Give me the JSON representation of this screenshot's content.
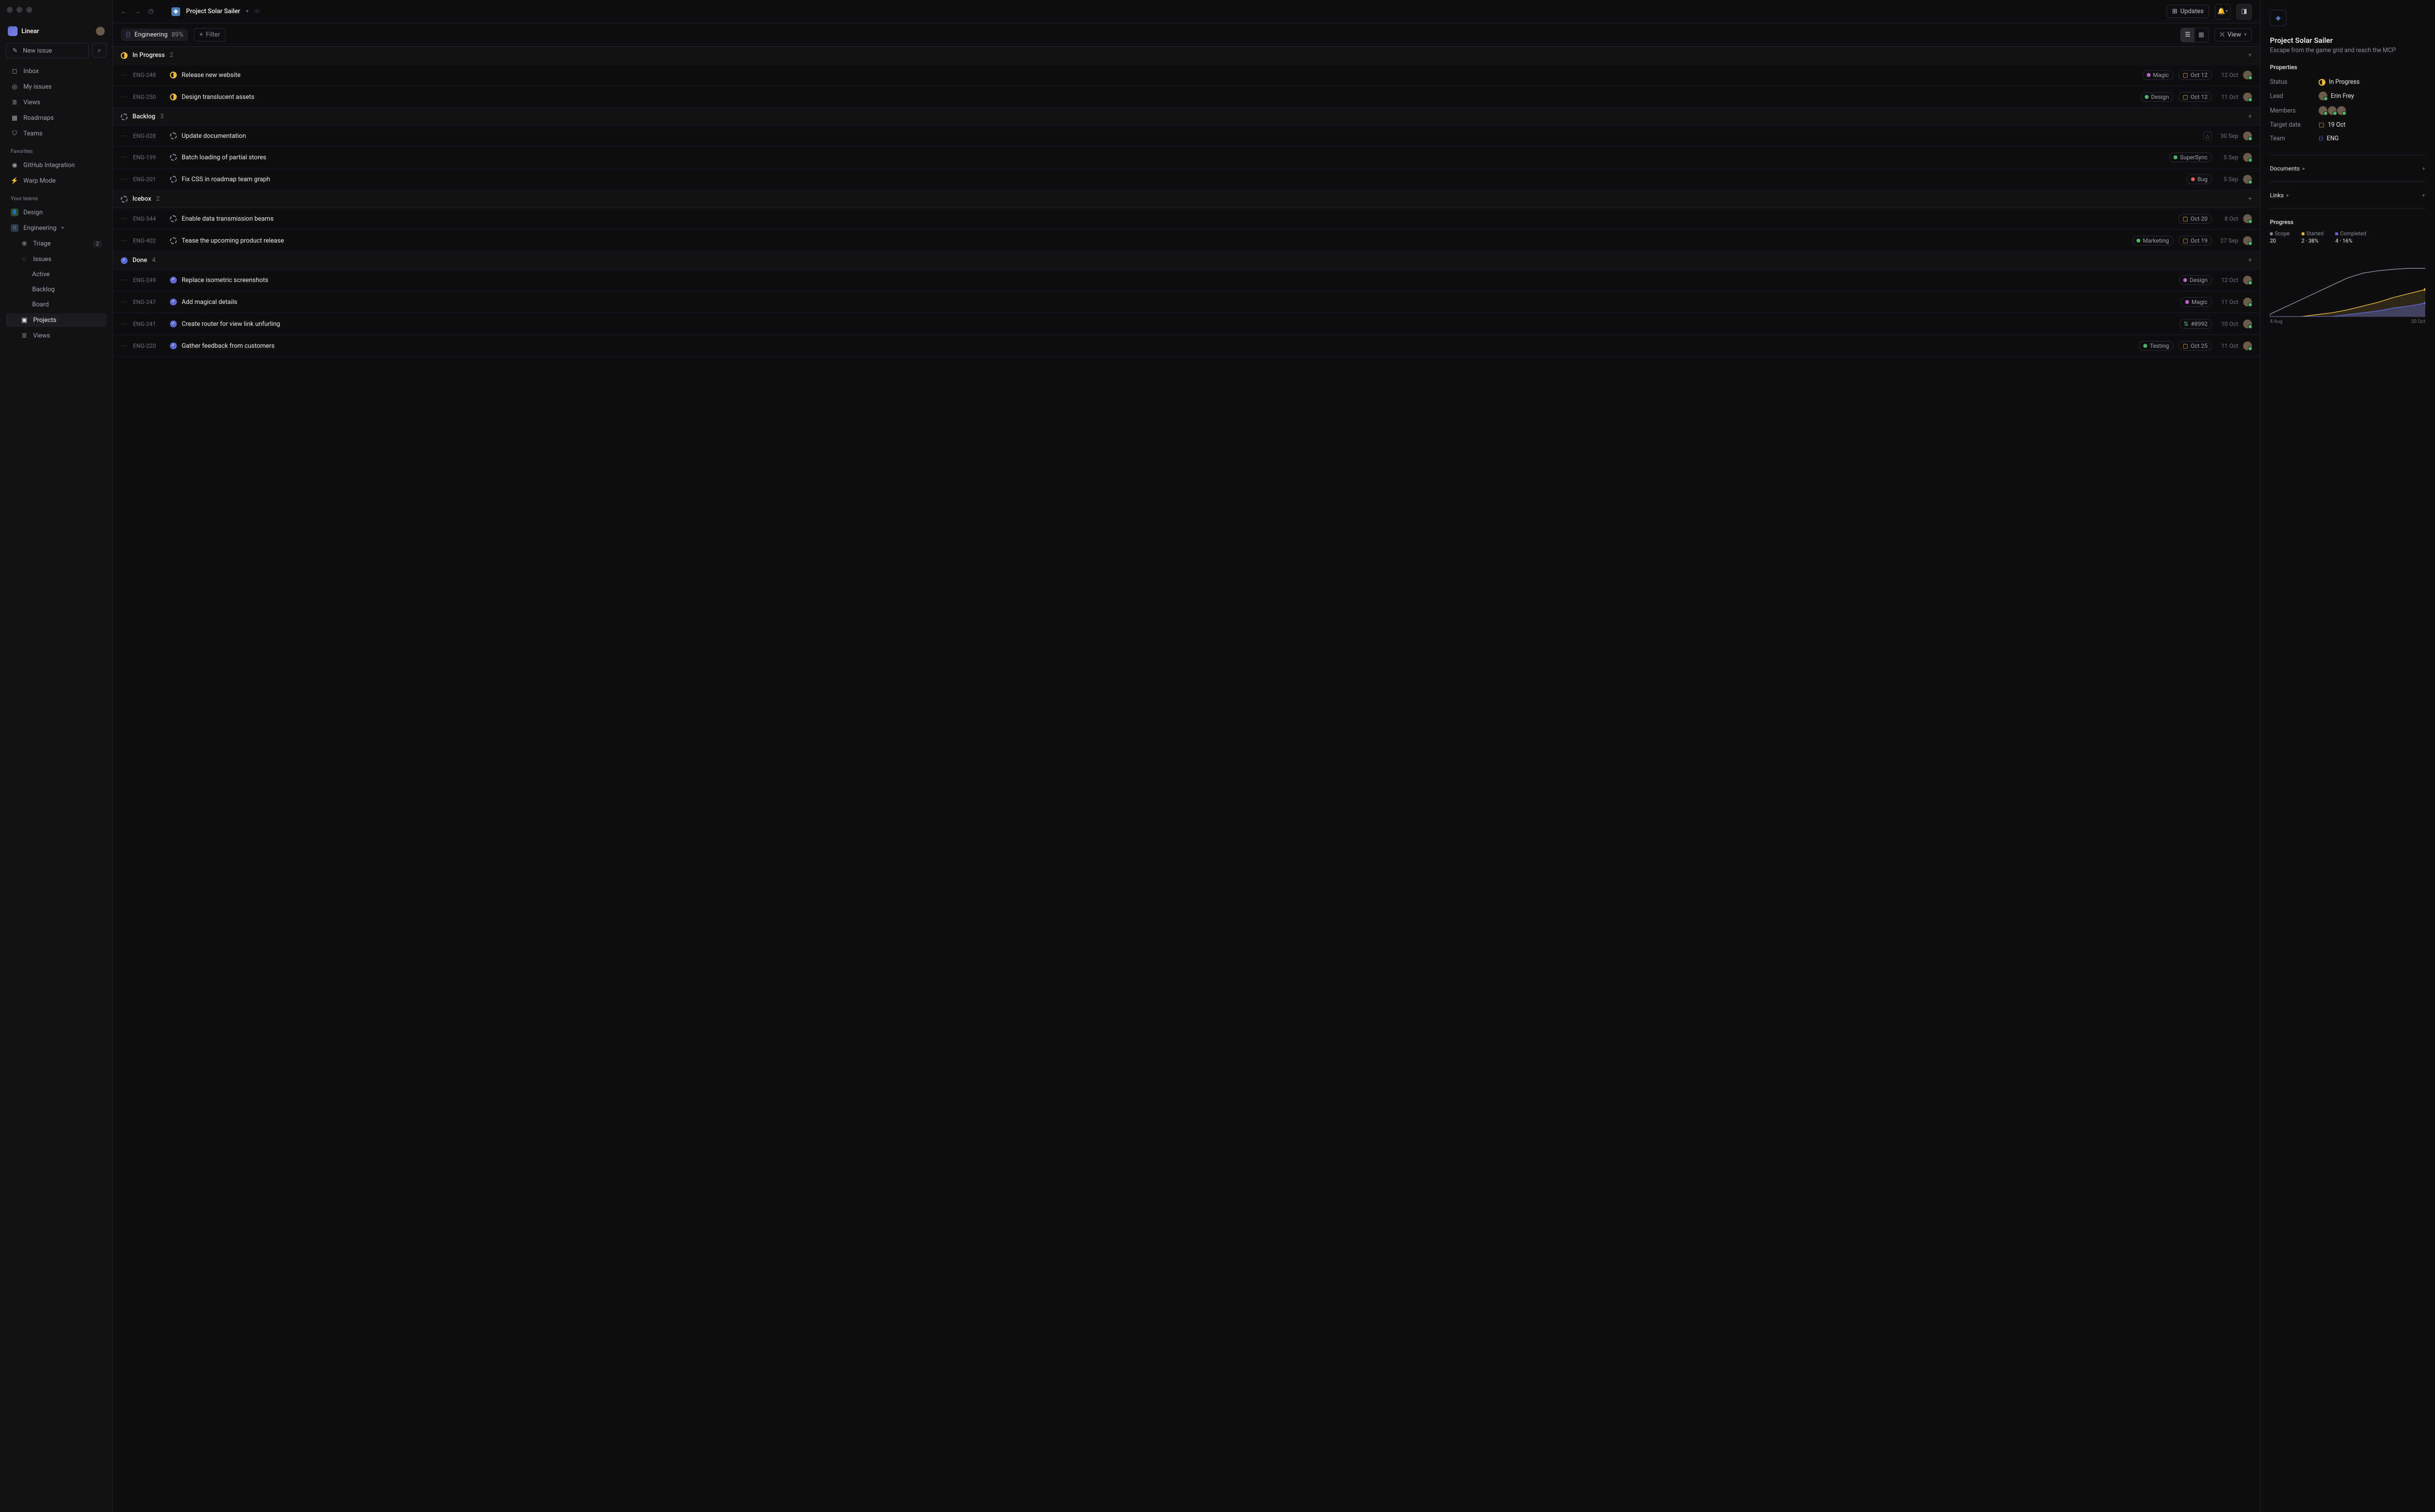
{
  "app": {
    "name": "Linear",
    "new_issue": "New issue"
  },
  "nav": {
    "inbox": "Inbox",
    "my_issues": "My issues",
    "views": "Views",
    "roadmaps": "Roadmaps",
    "teams": "Teams",
    "favorites": "Favorites",
    "github": "GitHub Integration",
    "warp": "Warp Mode",
    "your_teams": "Your teams",
    "design": "Design",
    "engineering": "Engineering",
    "triage": "Triage",
    "triage_cnt": "2",
    "issues": "Issues",
    "active": "Active",
    "backlog": "Backlog",
    "board": "Board",
    "projects": "Projects",
    "views2": "Views"
  },
  "header": {
    "project": "Project Solar Sailer",
    "updates": "Updates",
    "filter": "Filter",
    "view": "View"
  },
  "filter": {
    "team": "Engineering",
    "pct": "89%"
  },
  "groups": [
    {
      "status": "progress",
      "title": "In Progress",
      "count": "2",
      "items": [
        {
          "id": "ENG-248",
          "title": "Release new website",
          "label": "Magic",
          "label_color": "#b85ec9",
          "date": "Oct 12",
          "due": "12 Oct"
        },
        {
          "id": "ENG-250",
          "title": "Design translucent assets",
          "label": "Design",
          "label_color": "#4bb766",
          "date": "Oct 12",
          "due": "11 Oct"
        }
      ]
    },
    {
      "status": "backlog",
      "title": "Backlog",
      "count": "3",
      "items": [
        {
          "id": "ENG-028",
          "title": "Update documentation",
          "tri": true,
          "due": "30 Sep"
        },
        {
          "id": "ENG-199",
          "title": "Batch loading of partial stores",
          "label": "SuperSync",
          "label_color": "#4bb766",
          "due": "5 Sep"
        },
        {
          "id": "ENG-201",
          "title": "Fix CSS in roadmap team graph",
          "label": "Bug",
          "label_color": "#e05d5d",
          "due": "5 Sep"
        }
      ]
    },
    {
      "status": "backlog",
      "title": "Icebox",
      "count": "2",
      "items": [
        {
          "id": "ENG-344",
          "title": "Enable data transmission beams",
          "date": "Oct 20",
          "due": "8 Oct"
        },
        {
          "id": "ENG-402",
          "title": "Tease the upcoming product release",
          "label": "Marketing",
          "label_color": "#4bb766",
          "date": "Oct 19",
          "due": "27 Sep"
        }
      ]
    },
    {
      "status": "done",
      "title": "Done",
      "count": "4",
      "items": [
        {
          "id": "ENG-249",
          "title": "Replace isometric screenshots",
          "label": "Design",
          "label_color": "#b85ec9",
          "due": "12 Oct"
        },
        {
          "id": "ENG-247",
          "title": "Add magical details",
          "label": "Magic",
          "label_color": "#b85ec9",
          "due": "11 Oct"
        },
        {
          "id": "ENG-241",
          "title": "Create router for view link unfurling",
          "pr": "#8992",
          "due": "10 Oct"
        },
        {
          "id": "ENG-220",
          "title": "Gather feedback from customers",
          "label": "Testing",
          "label_color": "#4bb766",
          "date": "Oct 25",
          "due": "11 Oct"
        }
      ]
    }
  ],
  "details": {
    "title": "Project Solar Sailer",
    "subtitle": "Escape from the game grid and reach the MCP",
    "properties": "Properties",
    "status_lbl": "Status",
    "status_val": "In Progress",
    "lead_lbl": "Lead",
    "lead_val": "Erin Frey",
    "members_lbl": "Members",
    "target_lbl": "Target date",
    "target_val": "19 Oct",
    "team_lbl": "Team",
    "team_val": "ENG",
    "documents": "Documents",
    "links": "Links",
    "progress": "Progress",
    "legend": {
      "scope": "Scope",
      "scope_v": "20",
      "started": "Started",
      "started_v": "2 · 38%",
      "completed": "Completed",
      "completed_v": "4 · 16%"
    },
    "x_start": "4 Aug",
    "x_end": "20 Oct"
  },
  "chart_data": {
    "type": "area",
    "x": [
      "4 Aug",
      "20 Oct"
    ],
    "series": [
      {
        "name": "Scope",
        "color": "#8a8a92",
        "values": [
          0,
          2,
          4,
          6,
          8,
          10,
          12,
          14,
          15,
          16,
          17,
          18,
          19,
          19,
          20,
          20,
          20,
          20,
          20,
          20
        ]
      },
      {
        "name": "Started",
        "color": "#e8b73e",
        "values": [
          0,
          0,
          0,
          0,
          0,
          0,
          1,
          1,
          2,
          2,
          3,
          3,
          4,
          4,
          5,
          5,
          6,
          6,
          7,
          8
        ]
      },
      {
        "name": "Completed",
        "color": "#5e6ad2",
        "values": [
          0,
          0,
          0,
          0,
          0,
          0,
          0,
          0,
          0,
          0,
          1,
          1,
          1,
          2,
          2,
          2,
          3,
          3,
          3,
          4
        ]
      }
    ],
    "ylim": [
      0,
      20
    ]
  },
  "colors": {
    "progress": "#e8b73e",
    "done": "#5e6ad2",
    "backlog": "#8a8a92"
  }
}
